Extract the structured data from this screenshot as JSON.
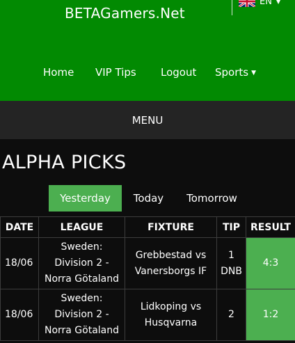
{
  "header": {
    "brand": "BETAGamers.Net",
    "language": {
      "code": "EN",
      "flag_icon": "uk-flag-icon"
    },
    "nav": [
      {
        "label": "Home"
      },
      {
        "label": "VIP Tips"
      },
      {
        "label": "Logout"
      },
      {
        "label": "Sports"
      }
    ]
  },
  "menubar": {
    "label": "MENU"
  },
  "section": {
    "title": "ALPHA PICKS",
    "tabs": [
      {
        "label": "Yesterday",
        "active": true
      },
      {
        "label": "Today",
        "active": false
      },
      {
        "label": "Tomorrow",
        "active": false
      }
    ]
  },
  "table": {
    "columns": [
      "DATE",
      "LEAGUE",
      "FIXTURE",
      "TIP",
      "RESULT"
    ],
    "rows": [
      {
        "date": "18/06",
        "league": [
          "Sweden:",
          "Division 2 -",
          "Norra Götaland"
        ],
        "fixture": [
          "Grebbestad vs",
          "Vanersborgs IF"
        ],
        "tip": [
          "1",
          "DNB"
        ],
        "result": "4:3"
      },
      {
        "date": "18/06",
        "league": [
          "Sweden:",
          "Division 2 -",
          "Norra Götaland"
        ],
        "fixture": [
          "Lidkoping vs",
          "Husqvarna"
        ],
        "tip": [
          "2"
        ],
        "result": "1:2"
      }
    ]
  },
  "colors": {
    "header_green": "#028a02",
    "accent_green": "#4caf50",
    "menubar": "#242424",
    "background": "#0d0d0d"
  }
}
